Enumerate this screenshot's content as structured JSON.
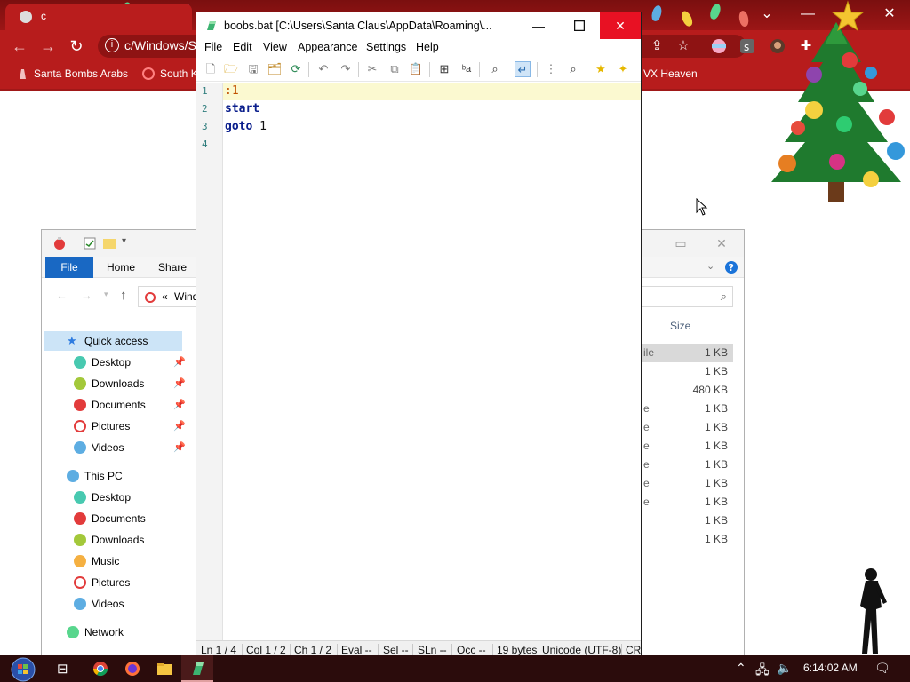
{
  "chrome": {
    "tab_title": "c",
    "address": "c/Windows/S",
    "bookmarks": [
      {
        "label": "Santa Bombs Arabs"
      },
      {
        "label": "South K"
      },
      {
        "label": "VX Heaven"
      }
    ]
  },
  "notepad": {
    "title": "boobs.bat [C:\\Users\\Santa Claus\\AppData\\Roaming\\...",
    "menu": [
      "File",
      "Edit",
      "View",
      "Appearance",
      "Settings",
      "Help"
    ],
    "lines": [
      {
        "number": "1",
        "text": ":1",
        "kind": "label"
      },
      {
        "number": "2",
        "text": "start",
        "kind": "keyword"
      },
      {
        "number": "3",
        "keyword": "goto",
        "arg": " 1",
        "kind": "goto"
      },
      {
        "number": "4",
        "text": "",
        "kind": "plain"
      }
    ],
    "status": {
      "ln": "Ln  1 / 4",
      "col": "Col  1 / 2",
      "ch": "Ch  1 / 2",
      "eval": "Eval  --",
      "sel": "Sel  --",
      "sln": "SLn  --",
      "occ": "Occ  --",
      "size": "19 bytes",
      "encoding": "Unicode (UTF-8)",
      "eol": "CR"
    },
    "accent": "#e81123"
  },
  "explorer": {
    "ribbon_tabs": [
      "File",
      "Home",
      "Share"
    ],
    "address": "Wind",
    "address_prefix": "«",
    "nav": [
      {
        "label": "Quick access",
        "level": 0,
        "icon": "star-icon"
      },
      {
        "label": "Desktop",
        "level": 1,
        "pinned": true
      },
      {
        "label": "Downloads",
        "level": 1,
        "pinned": true
      },
      {
        "label": "Documents",
        "level": 1,
        "pinned": true
      },
      {
        "label": "Pictures",
        "level": 1,
        "pinned": true
      },
      {
        "label": "Videos",
        "level": 1,
        "pinned": true
      },
      {
        "label": "This PC",
        "level": 0
      },
      {
        "label": "Desktop",
        "level": 1
      },
      {
        "label": "Documents",
        "level": 1
      },
      {
        "label": "Downloads",
        "level": 1
      },
      {
        "label": "Music",
        "level": 1
      },
      {
        "label": "Pictures",
        "level": 1
      },
      {
        "label": "Videos",
        "level": 1
      },
      {
        "label": "Network",
        "level": 0
      }
    ],
    "size_header": "Size",
    "files": [
      {
        "type_fragment": "ile",
        "size": "1 KB",
        "selected": true
      },
      {
        "type_fragment": "",
        "size": "1 KB"
      },
      {
        "type_fragment": "",
        "size": "480 KB"
      },
      {
        "type_fragment": "e",
        "size": "1 KB"
      },
      {
        "type_fragment": "e",
        "size": "1 KB"
      },
      {
        "type_fragment": "e",
        "size": "1 KB"
      },
      {
        "type_fragment": "e",
        "size": "1 KB"
      },
      {
        "type_fragment": "e",
        "size": "1 KB"
      },
      {
        "type_fragment": "e",
        "size": "1 KB"
      },
      {
        "type_fragment": "",
        "size": "1 KB"
      },
      {
        "type_fragment": "",
        "size": "1 KB"
      }
    ]
  },
  "taskbar": {
    "clock": "6:14:02 AM"
  }
}
